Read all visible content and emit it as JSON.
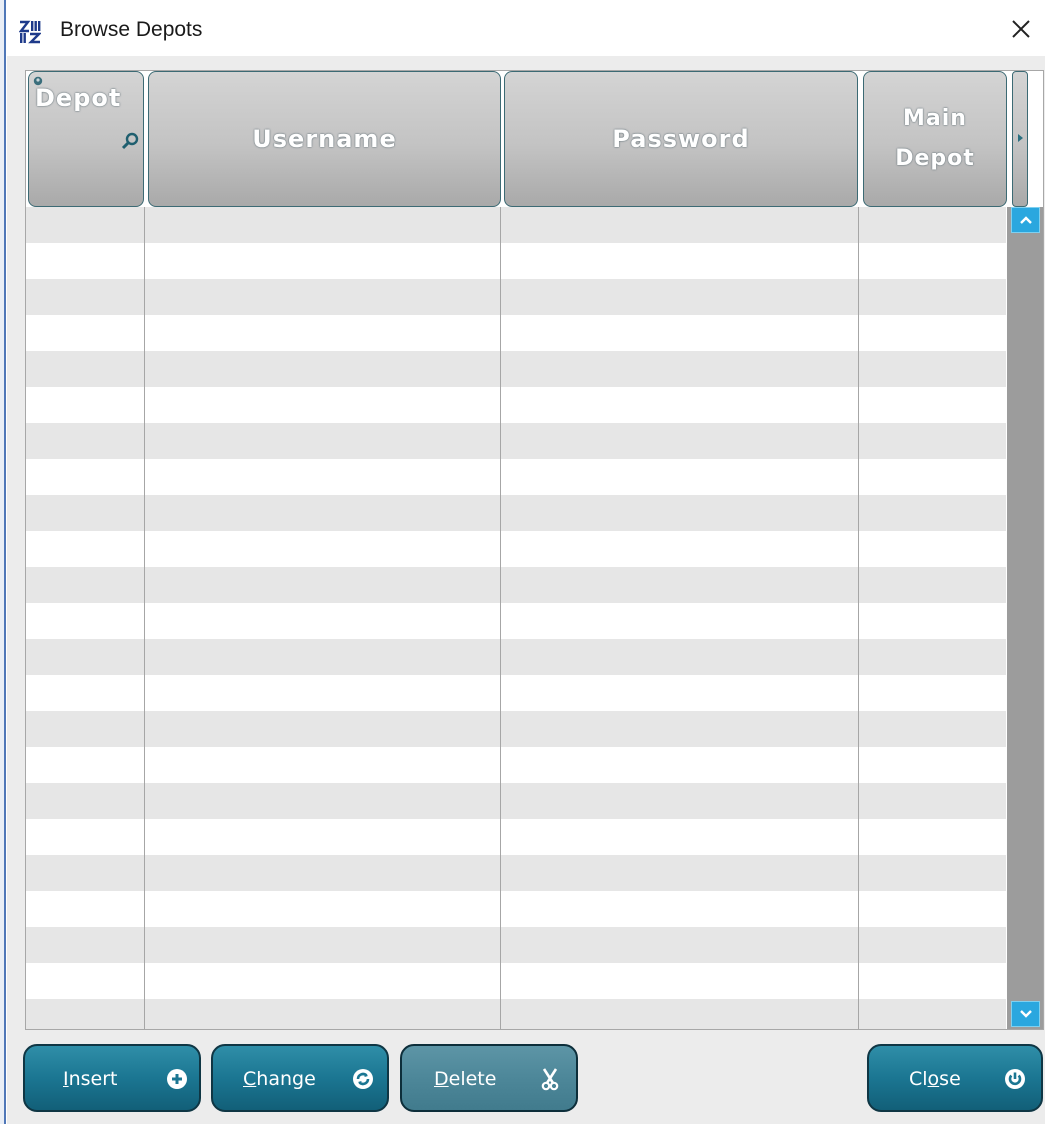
{
  "window": {
    "title": "Browse Depots",
    "close_glyph": "×"
  },
  "table": {
    "columns": [
      {
        "label": "Depot"
      },
      {
        "label": "Username"
      },
      {
        "label": "Password"
      },
      {
        "label": "Main Depot"
      }
    ],
    "empty_row_count": 23,
    "sort_column": "Depot"
  },
  "buttons": {
    "insert": {
      "prefix": "",
      "accel": "I",
      "rest": "nsert",
      "icon": "plus-circle-icon"
    },
    "change": {
      "prefix": "",
      "accel": "C",
      "rest": "hange",
      "icon": "refresh-icon"
    },
    "delete": {
      "prefix": "",
      "accel": "D",
      "rest": "elete",
      "icon": "scissors-icon"
    },
    "close": {
      "prefix": "Cl",
      "accel": "o",
      "rest": "se",
      "icon": "power-icon"
    }
  },
  "colors": {
    "header_gray": "#c3c3c3",
    "button_teal": "#1b7692",
    "scroll_button": "#2aa7df",
    "row_stripe": "#e6e6e6"
  }
}
